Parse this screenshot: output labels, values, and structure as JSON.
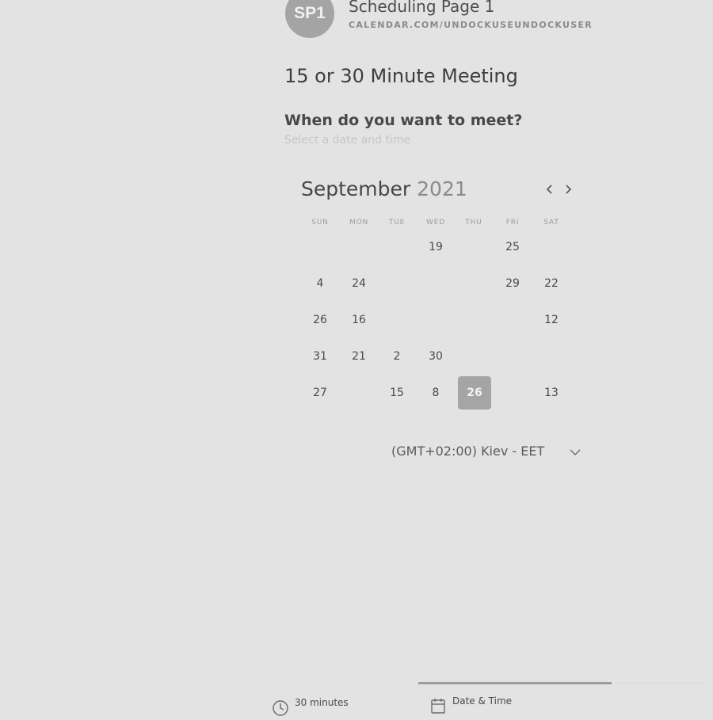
{
  "header": {
    "avatar_initials": "SP1",
    "page_name": "Scheduling Page 1",
    "page_url": "CALENDAR.COM/UNDOCKUSEUNDOCKUSER"
  },
  "meeting": {
    "title": "15 or 30 Minute Meeting",
    "question": "When do you want to meet?",
    "hint": "Select a date and time"
  },
  "calendar": {
    "month": "September",
    "year": "2021",
    "weekdays": [
      "SUN",
      "MON",
      "TUE",
      "WED",
      "THU",
      "FRI",
      "SAT"
    ],
    "rows": [
      [
        "",
        "",
        "",
        "19",
        "",
        "25",
        ""
      ],
      [
        "4",
        "24",
        "",
        "",
        "",
        "29",
        "22"
      ],
      [
        "26",
        "16",
        "",
        "",
        "",
        "",
        "12"
      ],
      [
        "31",
        "21",
        "2",
        "30",
        "",
        "",
        ""
      ],
      [
        "27",
        "",
        "15",
        "8",
        "26",
        "",
        "13"
      ]
    ],
    "selected_day": "26"
  },
  "timezone": {
    "value": "(GMT+02:00) Kiev - EET"
  },
  "steps": [
    {
      "label": "30 minutes",
      "icon": "clock-icon"
    },
    {
      "label": "Date & Time",
      "icon": "calendar-icon"
    }
  ],
  "colors": {
    "background": "#e3e3e3",
    "accent": "#a5a5a5",
    "text": "#3b3b3b"
  }
}
